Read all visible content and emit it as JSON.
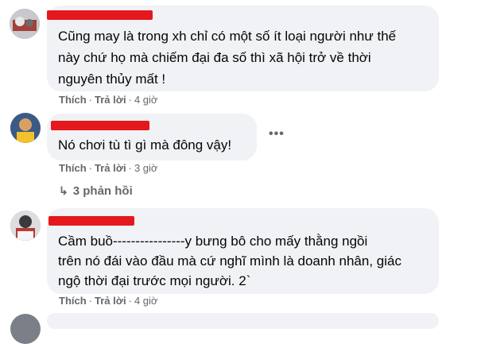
{
  "comments": [
    {
      "text_lines": [
        "Cũng may là trong xh chỉ có một số ít loại người như thế",
        "này chứ họ mà chiếm đại đa số thì xã hội trở về thời",
        "nguyên thủy mất !"
      ],
      "like_label": "Thích",
      "reply_label": "Trả lời",
      "time": "4 giờ"
    },
    {
      "text_lines": [
        "Nó chơi tù tì gì mà đông vậy!"
      ],
      "like_label": "Thích",
      "reply_label": "Trả lời",
      "time": "3 giờ",
      "more_icon": "more-options-icon",
      "replies_label": "3 phản hồi"
    },
    {
      "text_lines": [
        "Cầm buồ----------------y bưng bô cho mấy thằng ngồi",
        "trên nó đái vào đầu mà cứ nghĩ mình là doanh nhân, giác",
        "ngộ thời đại trước mọi người. 2`"
      ],
      "like_label": "Thích",
      "reply_label": "Trả lời",
      "time": "4 giờ"
    }
  ],
  "separator": "·",
  "colors": {
    "bubble": "#f0f2f5",
    "redaction": "#e4181d",
    "meta": "#65676b"
  }
}
